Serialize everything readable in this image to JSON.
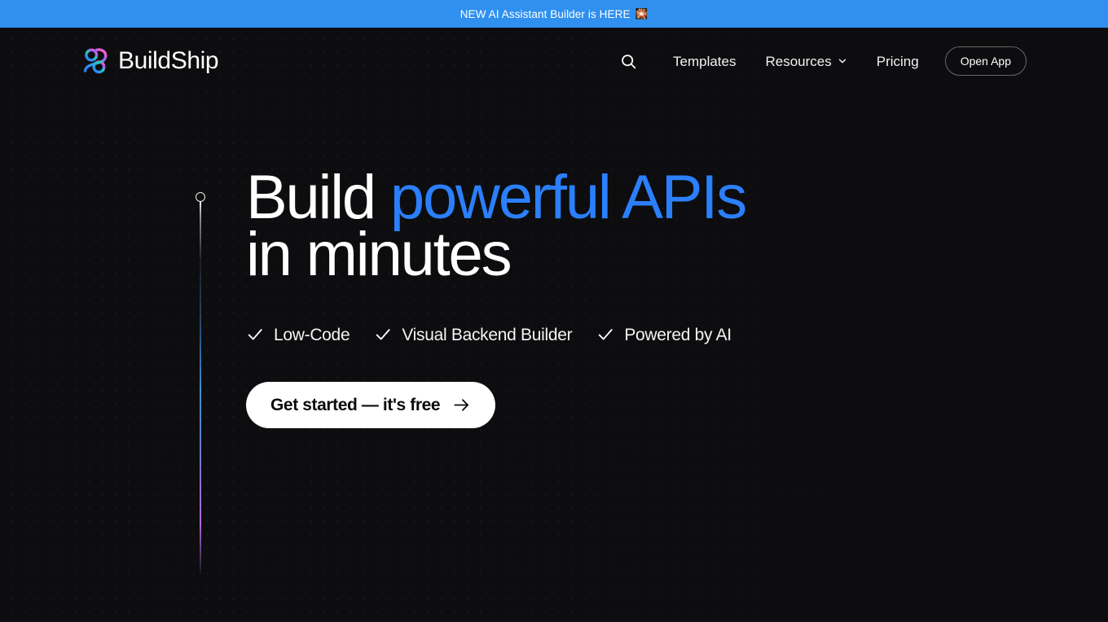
{
  "announcement": {
    "text": "NEW AI Assistant Builder is HERE",
    "emoji": "🎇",
    "background_color": "#2f90ef",
    "text_color": "#ffffff"
  },
  "header": {
    "brand_name": "BuildShip",
    "search_icon": "search-icon",
    "nav": [
      {
        "label": "Templates",
        "has_dropdown": false
      },
      {
        "label": "Resources",
        "has_dropdown": true
      },
      {
        "label": "Pricing",
        "has_dropdown": false
      }
    ],
    "open_app_label": "Open App"
  },
  "hero": {
    "headline": {
      "line1_part1": "Build ",
      "line1_accent": "powerful APIs",
      "line2": "in minutes",
      "accent_color": "#2b7ffb",
      "base_color": "#ffffff"
    },
    "features": [
      {
        "label": "Low-Code",
        "icon": "check-icon"
      },
      {
        "label": "Visual Backend Builder",
        "icon": "check-icon"
      },
      {
        "label": "Powered by AI",
        "icon": "check-icon"
      }
    ],
    "cta": {
      "label": "Get started — it's free",
      "icon": "arrow-right-icon",
      "background_color": "#ffffff",
      "text_color": "#0b0b0d"
    }
  },
  "theme": {
    "page_background": "#0d0d0f",
    "logo_gradient_start": "#ff5fd2",
    "logo_gradient_mid": "#23d3b0",
    "logo_gradient_end": "#2b7ffb",
    "rail_gradient_top": "#f2f2f2",
    "rail_gradient_mid": "#3f8fd8",
    "rail_gradient_bottom": "#b26ad6"
  }
}
